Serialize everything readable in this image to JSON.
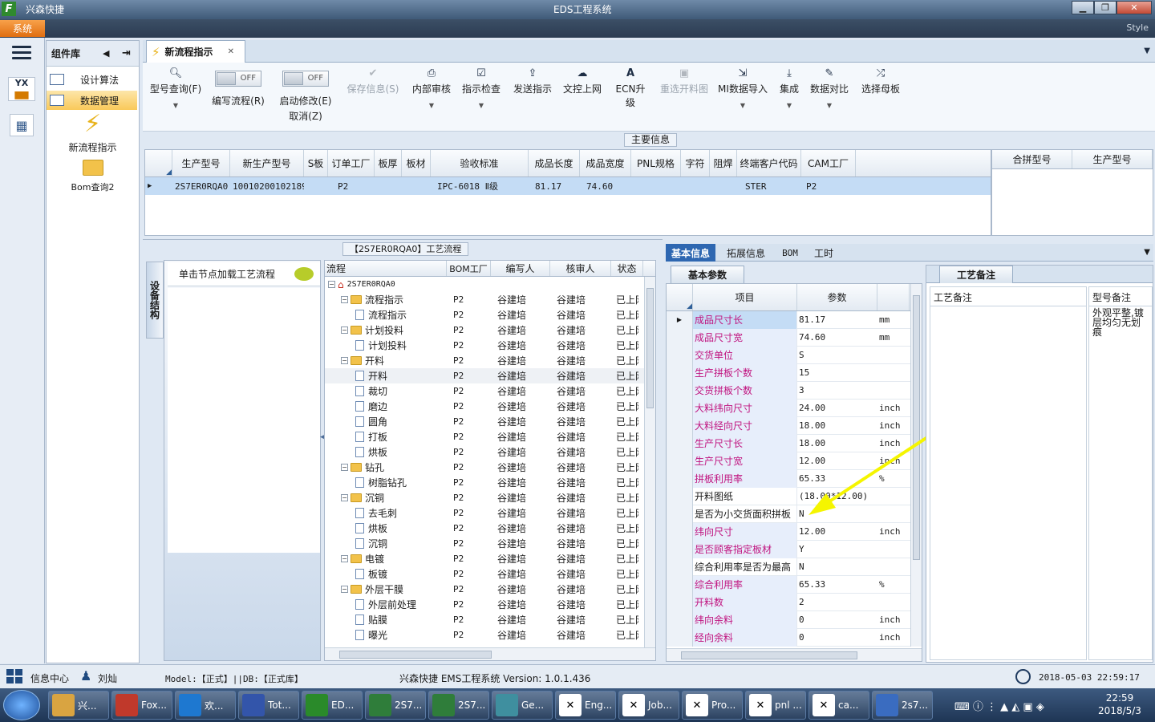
{
  "window": {
    "app_name": "兴森快捷",
    "title": "EDS工程系统",
    "min": "▁",
    "max": "❐",
    "close": "✕"
  },
  "menubar": {
    "system": "系统",
    "style": "Style"
  },
  "components": {
    "header": "组件库",
    "items": [
      {
        "label": "设计算法"
      },
      {
        "label": "数据管理"
      }
    ],
    "tools": [
      {
        "label": "新流程指示"
      },
      {
        "label": "Bom查询2"
      }
    ]
  },
  "main_tab": {
    "label": "新流程指示",
    "close": "✕"
  },
  "toolbar": {
    "model_query": "型号查询(F)",
    "edit_flow": "编写流程(R)",
    "toggle_off": "OFF",
    "enable_edit": "启动修改(E)",
    "cancel": "取消(Z)",
    "save_info": "保存信息(S)",
    "internal_review": "内部审核",
    "instr_check": "指示检查",
    "send_instr": "发送指示",
    "doc_upload": "文控上网",
    "ecn_upgrade": "ECN升级",
    "reselect_map": "重选开料图",
    "mi_import": "MI数据导入",
    "integrate": "集成",
    "data_compare": "数据对比",
    "select_mother": "选择母板"
  },
  "main_info": {
    "title": "主要信息",
    "columns": [
      "生产型号",
      "新生产型号",
      "S板",
      "订单工厂",
      "板厚",
      "板材",
      "验收标准",
      "成品长度",
      "成品宽度",
      "PNL规格",
      "字符",
      "阻焊",
      "终端客户代码",
      "CAM工厂"
    ],
    "row": [
      "2S7ER0RQA0",
      "10010200102189",
      "",
      "P2",
      "",
      "",
      "IPC-6018 Ⅱ级",
      "81.17",
      "74.60",
      "",
      "",
      "",
      "STER",
      "P2"
    ],
    "side_columns": [
      "合拼型号",
      "生产型号"
    ]
  },
  "process": {
    "title": "【2S7ER0RQA0】工艺流程",
    "side_tab": "设备结构",
    "hint": "单击节点加载工艺流程",
    "columns": [
      "流程",
      "BOM工厂",
      "编写人",
      "核审人",
      "状态"
    ],
    "root": "2S7ER0RQA0",
    "rows": [
      {
        "name": "流程指示",
        "level": 1,
        "folder": true
      },
      {
        "name": "流程指示",
        "level": 2,
        "folder": false
      },
      {
        "name": "计划投料",
        "level": 1,
        "folder": true
      },
      {
        "name": "计划投料",
        "level": 2,
        "folder": false
      },
      {
        "name": "开料",
        "level": 1,
        "folder": true
      },
      {
        "name": "开料",
        "level": 2,
        "folder": false
      },
      {
        "name": "裁切",
        "level": 2,
        "folder": false
      },
      {
        "name": "磨边",
        "level": 2,
        "folder": false
      },
      {
        "name": "圆角",
        "level": 2,
        "folder": false
      },
      {
        "name": "打板",
        "level": 2,
        "folder": false
      },
      {
        "name": "烘板",
        "level": 2,
        "folder": false
      },
      {
        "name": "钻孔",
        "level": 1,
        "folder": true
      },
      {
        "name": "树脂钻孔",
        "level": 2,
        "folder": false
      },
      {
        "name": "沉铜",
        "level": 1,
        "folder": true
      },
      {
        "name": "去毛刺",
        "level": 2,
        "folder": false
      },
      {
        "name": "烘板",
        "level": 2,
        "folder": false
      },
      {
        "name": "沉铜",
        "level": 2,
        "folder": false
      },
      {
        "name": "电镀",
        "level": 1,
        "folder": true
      },
      {
        "name": "板镀",
        "level": 2,
        "folder": false
      },
      {
        "name": "外层干膜",
        "level": 1,
        "folder": true
      },
      {
        "name": "外层前处理",
        "level": 2,
        "folder": false
      },
      {
        "name": "贴膜",
        "level": 2,
        "folder": false
      },
      {
        "name": "曝光",
        "level": 2,
        "folder": false
      }
    ],
    "factory": "P2",
    "writer": "谷建培",
    "reviewer": "谷建培",
    "status": "已上网"
  },
  "basic": {
    "tabs": [
      "基本信息",
      "拓展信息",
      "BOM",
      "工时"
    ],
    "subtab": "基本参数",
    "columns": [
      "项目",
      "参数"
    ],
    "rows": [
      {
        "name": "成品尺寸长",
        "value": "81.17",
        "unit": "mm",
        "m": true
      },
      {
        "name": "成品尺寸宽",
        "value": "74.60",
        "unit": "mm",
        "m": true
      },
      {
        "name": "交货单位",
        "value": "S",
        "unit": "",
        "m": true
      },
      {
        "name": "生产拼板个数",
        "value": "15",
        "unit": "",
        "m": true
      },
      {
        "name": "交货拼板个数",
        "value": "3",
        "unit": "",
        "m": true
      },
      {
        "name": "大料纬向尺寸",
        "value": "24.00",
        "unit": "inch",
        "m": true
      },
      {
        "name": "大料经向尺寸",
        "value": "18.00",
        "unit": "inch",
        "m": true
      },
      {
        "name": "生产尺寸长",
        "value": "18.00",
        "unit": "inch",
        "m": true
      },
      {
        "name": "生产尺寸宽",
        "value": "12.00",
        "unit": "inch",
        "m": true
      },
      {
        "name": "拼板利用率",
        "value": "65.33",
        "unit": "%",
        "m": true
      },
      {
        "name": "开料图纸",
        "value": "(18.00*12.00)",
        "unit": "",
        "m": false
      },
      {
        "name": "是否为小交货面积拼板",
        "value": "N",
        "unit": "",
        "m": false
      },
      {
        "name": "纬向尺寸",
        "value": "12.00",
        "unit": "inch",
        "m": true
      },
      {
        "name": "是否顾客指定板材",
        "value": "Y",
        "unit": "",
        "m": true
      },
      {
        "name": "综合利用率是否为最高",
        "value": "N",
        "unit": "",
        "m": false
      },
      {
        "name": "综合利用率",
        "value": "65.33",
        "unit": "%",
        "m": true
      },
      {
        "name": "开料数",
        "value": "2",
        "unit": "",
        "m": true
      },
      {
        "name": "纬向余料",
        "value": "0",
        "unit": "inch",
        "m": true
      },
      {
        "name": "经向余料",
        "value": "0",
        "unit": "inch",
        "m": true
      }
    ]
  },
  "remarks": {
    "tab": "工艺备注",
    "columns": [
      "工艺备注",
      "型号备注"
    ],
    "model_note": "外观平整,镀层均匀无划痕"
  },
  "statusbar": {
    "info_center": "信息中心",
    "user": "刘灿",
    "model_db": "Model:【正式】||DB:【正式库】",
    "version": "兴森快捷 EMS工程系统 Version: 1.0.1.436",
    "datetime": "2018-05-03 22:59:17"
  },
  "taskbar": {
    "items": [
      {
        "label": "兴..."
      },
      {
        "label": "Fox..."
      },
      {
        "label": "欢..."
      },
      {
        "label": "Tot..."
      },
      {
        "label": "ED..."
      },
      {
        "label": "2S7..."
      },
      {
        "label": "2S7..."
      },
      {
        "label": "Ge..."
      },
      {
        "label": "Eng..."
      },
      {
        "label": "Job..."
      },
      {
        "label": "Pro..."
      },
      {
        "label": "pnl ..."
      },
      {
        "label": "ca..."
      },
      {
        "label": "2s7..."
      }
    ],
    "time": "22:59",
    "date": "2018/5/3"
  },
  "colors": {
    "accent_orange": "#e8801f",
    "magenta_label": "#c0137f",
    "selection_row": "#c4dcf5",
    "annotation_arrow": "#f5f500"
  }
}
